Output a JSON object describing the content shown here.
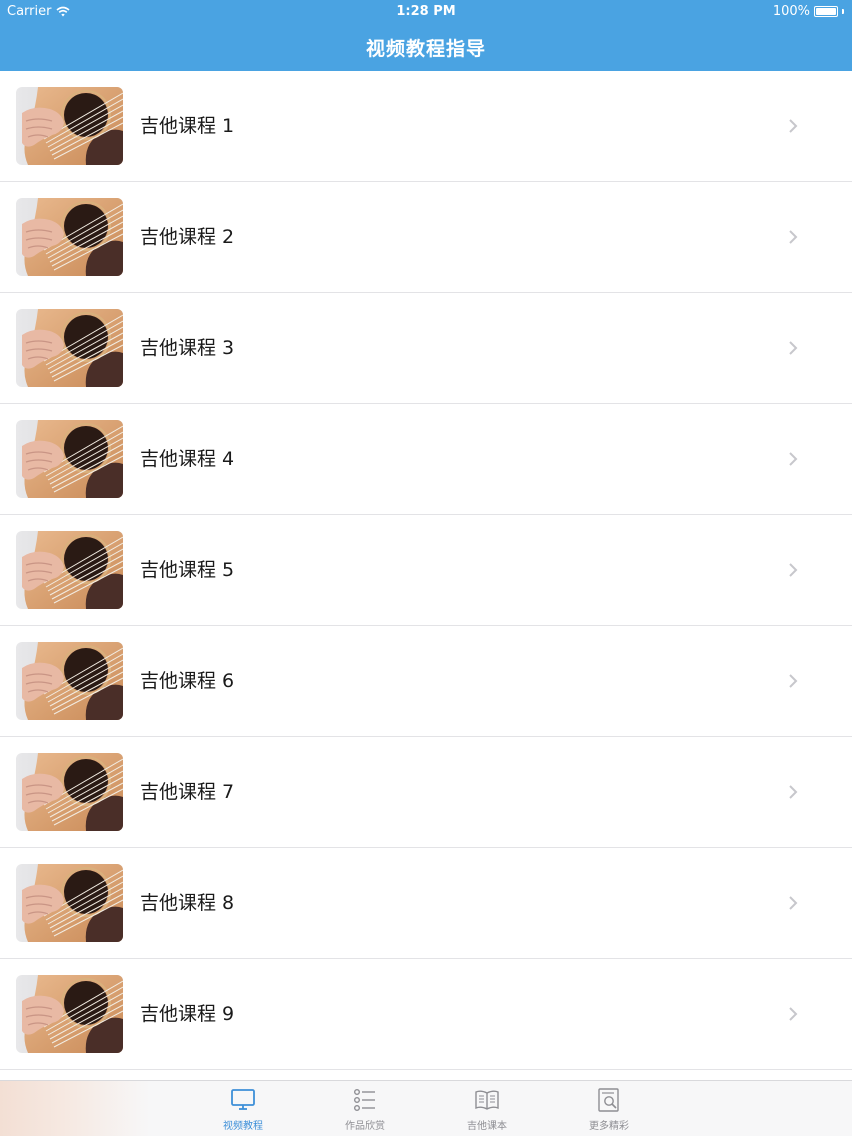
{
  "status_bar": {
    "carrier": "Carrier",
    "time": "1:28 PM",
    "battery": "100%"
  },
  "nav": {
    "title": "视频教程指导"
  },
  "rows": [
    {
      "label": "吉他课程 1"
    },
    {
      "label": "吉他课程 2"
    },
    {
      "label": "吉他课程 3"
    },
    {
      "label": "吉他课程 4"
    },
    {
      "label": "吉他课程 5"
    },
    {
      "label": "吉他课程 6"
    },
    {
      "label": "吉他课程 7"
    },
    {
      "label": "吉他课程 8"
    },
    {
      "label": "吉他课程 9"
    }
  ],
  "tab_bar": {
    "tabs": [
      {
        "label": "视频教程",
        "icon": "monitor-icon",
        "active": true
      },
      {
        "label": "作品欣赏",
        "icon": "list-icon",
        "active": false
      },
      {
        "label": "吉他课本",
        "icon": "book-icon",
        "active": false
      },
      {
        "label": "更多精彩",
        "icon": "document-search-icon",
        "active": false
      }
    ]
  },
  "colors": {
    "accent": "#4aa3e2",
    "tab_active": "#3d8fd8",
    "tab_inactive": "#8e8e93",
    "separator": "#e3e3e6",
    "chevron": "#c7c7cc"
  }
}
